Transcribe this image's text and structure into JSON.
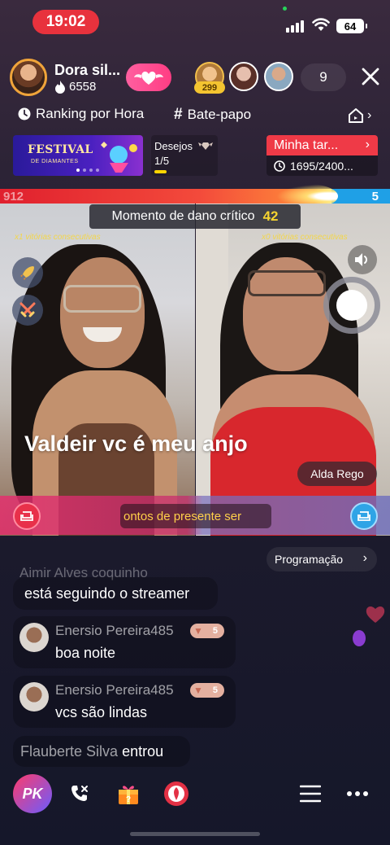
{
  "status_bar": {
    "time": "19:02",
    "battery": "64"
  },
  "host": {
    "name": "Dora sil...",
    "likes": "6558"
  },
  "viewers": {
    "top_badge": "299",
    "count": "9"
  },
  "nav": {
    "ranking": "Ranking por Hora",
    "chat": "Bate-papo"
  },
  "festival": {
    "title": "FESTIVAL",
    "subtitle": "DE DIAMANTES"
  },
  "desires": {
    "label": "Desejos",
    "value": "1/5",
    "progress": 0.2
  },
  "task": {
    "label": "Minha tar...",
    "progress_text": "1695/2400..."
  },
  "pk": {
    "left_score": "912",
    "right_score": "5",
    "left_share": 0.85,
    "critical_label": "Momento de dano crítico",
    "critical_count": "42"
  },
  "streaks": {
    "left": "x1 vitórias consecutivas",
    "right": "x0 vitórias consecutivas"
  },
  "video": {
    "big_comment": "Valdeir vc é meu anjo",
    "guest_name": "Alda Rego"
  },
  "gift_ticker": "ontos de presente ser",
  "chat": {
    "programacao": "Programação",
    "ghost_name": "Aimir Alves coquinho",
    "messages": [
      {
        "text": "está seguindo o streamer"
      },
      {
        "user": "Enersio Pereira485",
        "level": "5",
        "text": "boa noite"
      },
      {
        "user": "Enersio Pereira485",
        "level": "5",
        "text": "vcs são lindas"
      }
    ],
    "entered": {
      "user": "Flauberte Silva",
      "action": "entrou"
    }
  },
  "bottom": {
    "pk_label": "PK"
  },
  "colors": {
    "pk_red": "#e0202e",
    "pk_blue": "#1fa0e6",
    "accent_pink": "#ff3d83",
    "gold": "#f6d430"
  }
}
